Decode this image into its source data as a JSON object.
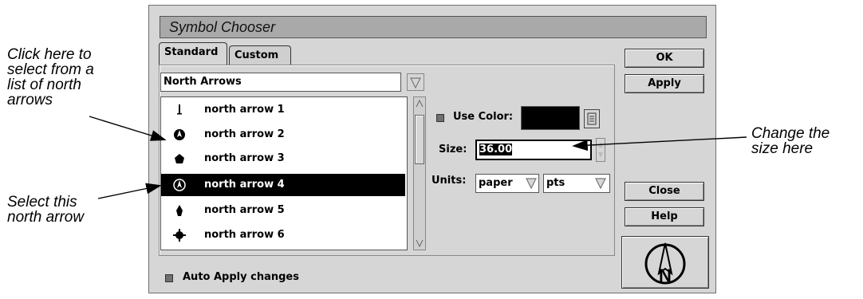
{
  "callouts": {
    "arrows_list": [
      "Click here to",
      "select from a",
      "list of north",
      "arrows"
    ],
    "select_arrow": [
      "Select this",
      "north arrow"
    ],
    "change_size": [
      "Change the",
      "size here"
    ]
  },
  "dialog": {
    "title": "Symbol Chooser",
    "tabs": [
      "Standard",
      "Custom"
    ],
    "dropdown_value": "North Arrows",
    "list_items": [
      "north arrow 1",
      "north arrow 2",
      "north arrow 3",
      "north arrow 4",
      "north arrow 5",
      "north arrow 6"
    ],
    "selected_index": 3,
    "use_color_label": "Use Color:",
    "size_label": "Size:",
    "size_value": "36.00",
    "units_label": "Units:",
    "units_value": "paper",
    "units_measure": "pts",
    "auto_apply_label": "Auto Apply changes",
    "buttons": {
      "ok": "OK",
      "apply": "Apply",
      "close": "Close",
      "help": "Help"
    },
    "preview_icon": "north-arrow-compass"
  }
}
